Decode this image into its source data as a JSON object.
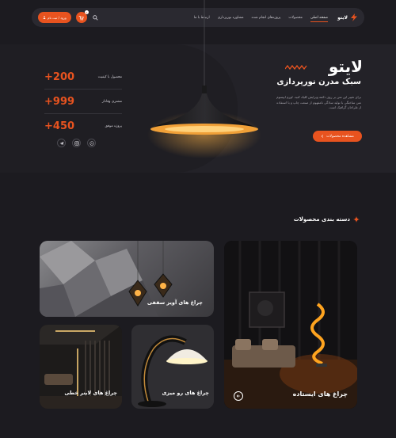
{
  "nav": {
    "logo": "لایتو",
    "links": [
      {
        "label": "صفحه اصلی",
        "active": true
      },
      {
        "label": "محصولات",
        "active": false
      },
      {
        "label": "پروژه‌های انجام شده",
        "active": false
      },
      {
        "label": "مشاوره نورپردازی",
        "active": false
      },
      {
        "label": "ارتباط با ما",
        "active": false
      }
    ],
    "login_label": "ورود / ثبت نام",
    "cart_count": "0"
  },
  "hero": {
    "title": "لایتو",
    "subtitle": "سبک مدرن نورپردازی",
    "description": "برای تغییر این متن بر روی دکمه ویرایش کلیک کنید. لورم ایپسوم متن ساختگی با تولید سادگی نامفهوم از صنعت چاپ و با استفاده از طراحان گرافیک است.",
    "cta_label": "مشاهده محصولات"
  },
  "stats": [
    {
      "value": "+200",
      "label": "محصول با کیفیت"
    },
    {
      "value": "+999",
      "label": "مشتری وفادار"
    },
    {
      "value": "+450",
      "label": "پروژه موفق"
    }
  ],
  "socials": [
    "telegram-icon",
    "instagram-icon",
    "whatsapp-icon"
  ],
  "categories": {
    "heading": "دسته بندی محصولات",
    "items": [
      {
        "label": "چراغ های آویز سقفی"
      },
      {
        "label": "چراغ های ایستاده"
      },
      {
        "label": "چراغ های رو میزی"
      },
      {
        "label": "چراغ های لاینر خطی"
      }
    ]
  },
  "colors": {
    "accent": "#e8531f",
    "background": "#1c1b20",
    "surface": "#2a2930"
  }
}
